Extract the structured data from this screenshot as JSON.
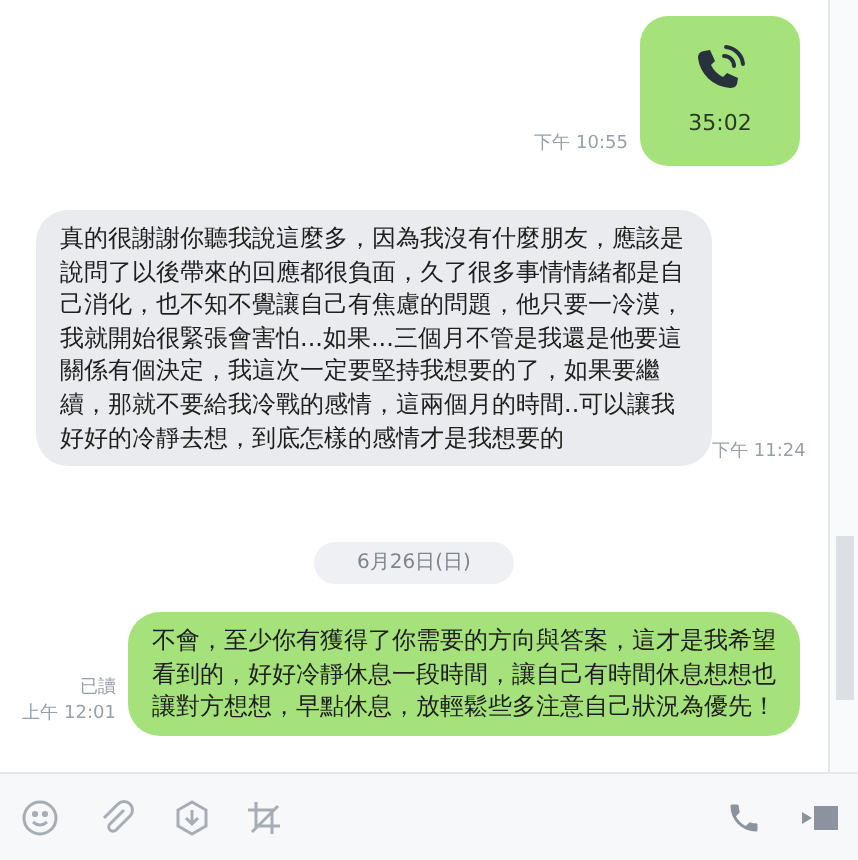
{
  "messages": [
    {
      "kind": "call",
      "outgoing": true,
      "duration": "35:02",
      "time": "下午 10:55"
    },
    {
      "kind": "text",
      "outgoing": false,
      "text": "真的很謝謝你聽我說這麼多，因為我沒有什麼朋友，應該是說問了以後帶來的回應都很負面，久了很多事情情緒都是自己消化，也不知不覺讓自己有焦慮的問題，他只要一冷漠，我就開始很緊張會害怕...如果...三個月不管是我還是他要這關係有個決定，我這次一定要堅持我想要的了，如果要繼續，那就不要給我冷戰的感情，這兩個月的時間..可以讓我好好的冷靜去想，到底怎樣的感情才是我想要的",
      "time": "下午 11:24"
    },
    {
      "kind": "date",
      "text": "6月26日(日)"
    },
    {
      "kind": "text",
      "outgoing": true,
      "text": "不會，至少你有獲得了你需要的方向與答案，這才是我希望看到的，好好冷靜休息一段時間，讓自己有時間休息想想也讓對方想想，早點休息，放輕鬆些多注意自己狀況為優先！",
      "read": "已讀",
      "time": "上午 12:01"
    }
  ]
}
